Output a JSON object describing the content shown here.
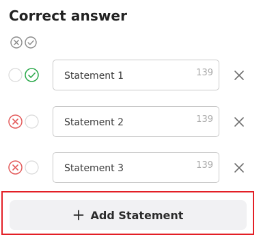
{
  "title": "Correct answer",
  "icons": {
    "legend_wrong": "circle-x-icon",
    "legend_correct": "circle-check-icon",
    "remove": "close-icon",
    "add": "plus-icon"
  },
  "colors": {
    "wrong": "#e35a5a",
    "correct": "#2aa84a",
    "neutral": "#8a8a8a",
    "highlight": "#e31f26"
  },
  "statements": [
    {
      "text": "Statement 1",
      "count": "139",
      "state": "correct"
    },
    {
      "text": "Statement 2",
      "count": "139",
      "state": "wrong"
    },
    {
      "text": "Statement 3",
      "count": "139",
      "state": "wrong"
    }
  ],
  "add_label": "Add Statement"
}
